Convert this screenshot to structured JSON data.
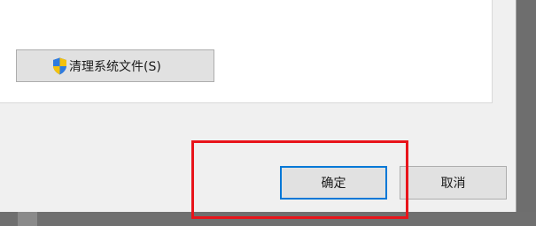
{
  "dialog": {
    "system_button": {
      "label": "清理系统文件(S)",
      "icon": "uac-shield-icon"
    },
    "ok_button": {
      "label": "确定"
    },
    "cancel_button": {
      "label": "取消"
    }
  },
  "colors": {
    "highlight_border": "#e8141b",
    "focus_border": "#0078d7",
    "dialog_bg": "#f0f0f0",
    "button_bg": "#e1e1e1"
  }
}
